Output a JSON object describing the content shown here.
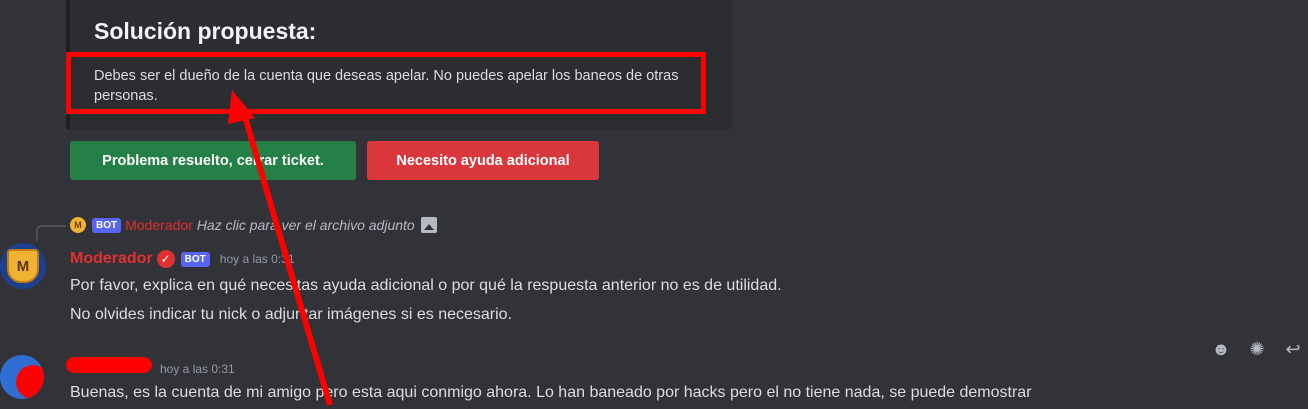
{
  "embed": {
    "title": "Solución propuesta:",
    "description": "Debes ser el dueño de la cuenta que deseas apelar. No puedes apelar los baneos de otras personas."
  },
  "buttons": {
    "resolved": "Problema resuelto, cerrar ticket.",
    "need_help": "Necesito ayuda adicional"
  },
  "reply": {
    "avatar_letter": "M",
    "bot_tag": "BOT",
    "name": "Moderador",
    "text": "Haz clic para ver el archivo adjunto"
  },
  "message1": {
    "avatar_letter": "M",
    "author": "Moderador",
    "bot_tag": "BOT",
    "timestamp": "hoy a las 0:31",
    "line1": "Por favor, explica en qué necesitas ayuda adicional o por qué la respuesta anterior no es de utilidad.",
    "line2": "No olvides indicar tu nick o adjuntar imágenes si es necesario."
  },
  "message2": {
    "timestamp": "hoy a las 0:31",
    "text": "Buenas, es la cuenta de mi amigo pero esta aqui conmigo ahora. Lo han baneado por hacks pero el no tiene nada, se puede demostrar"
  },
  "toolbar": {
    "icons": [
      "add-reaction-icon",
      "super-reaction-icon",
      "reply-icon"
    ]
  },
  "colors": {
    "background": "#313338",
    "embed_bg": "#2b2d31",
    "green_button": "#248046",
    "red_button": "#da373c",
    "moderator_name": "#e0302f",
    "annotation_red": "#ff0000"
  }
}
